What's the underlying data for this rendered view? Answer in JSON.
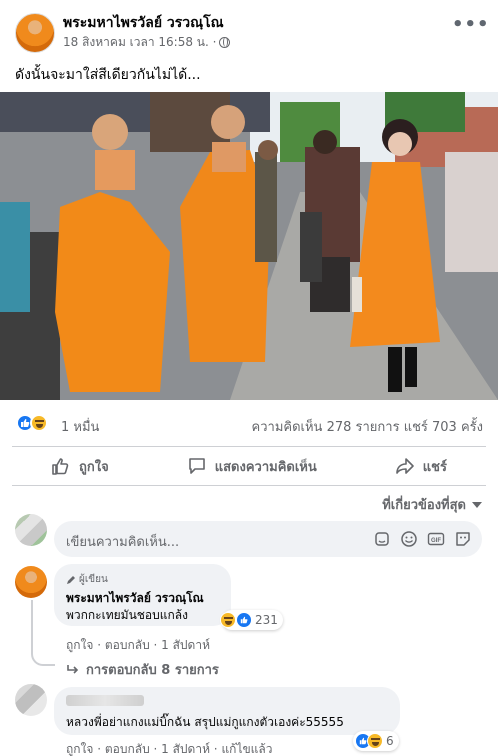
{
  "post": {
    "author": "พระมหาไพรวัลย์ วรวณฺโณ",
    "timestamp": "18 สิงหาคม เวลา 16:58 น. ·",
    "text": "ดังนั้นจะมาใส่สีเดียวกันไม่ได้...",
    "photo_alt": "monks in orange robes receiving alms beside a person in an orange dress",
    "reaction_count": "1 หมื่น",
    "comment_share_stats": "ความคิดเห็น 278 รายการ   แชร์ 703 ครั้ง"
  },
  "actions": {
    "like": "ถูกใจ",
    "comment": "แสดงความคิดเห็น",
    "share": "แชร์"
  },
  "sort_label": "ที่เกี่ยวข้องที่สุด",
  "composer": {
    "placeholder": "เขียนความคิดเห็น..."
  },
  "comments": [
    {
      "badge": "ผู้เขียน",
      "author": "พระมหาไพรวัลย์ วรวณฺโณ",
      "text": "พวกกะเทยมันชอบแกล้ง",
      "reactions": "231",
      "actions_line": "ถูกใจ · ตอบกลับ · 1 สัปดาห์",
      "replies": "การตอบกลับ 8 รายการ"
    },
    {
      "text": "หลวงพี่อย่าแกงแม่บิ๊กฉัน สรุปแม่กูแกงตัวเองค่ะ55555",
      "reactions": "6",
      "actions_line": "ถูกใจ · ตอบกลับ · 1 สัปดาห์ · แก้ไขแล้ว"
    }
  ],
  "colors": {
    "accent": "#1877f2",
    "robe": "#f08a1c",
    "muted_text": "#65676b",
    "bubble": "#f0f2f5"
  }
}
